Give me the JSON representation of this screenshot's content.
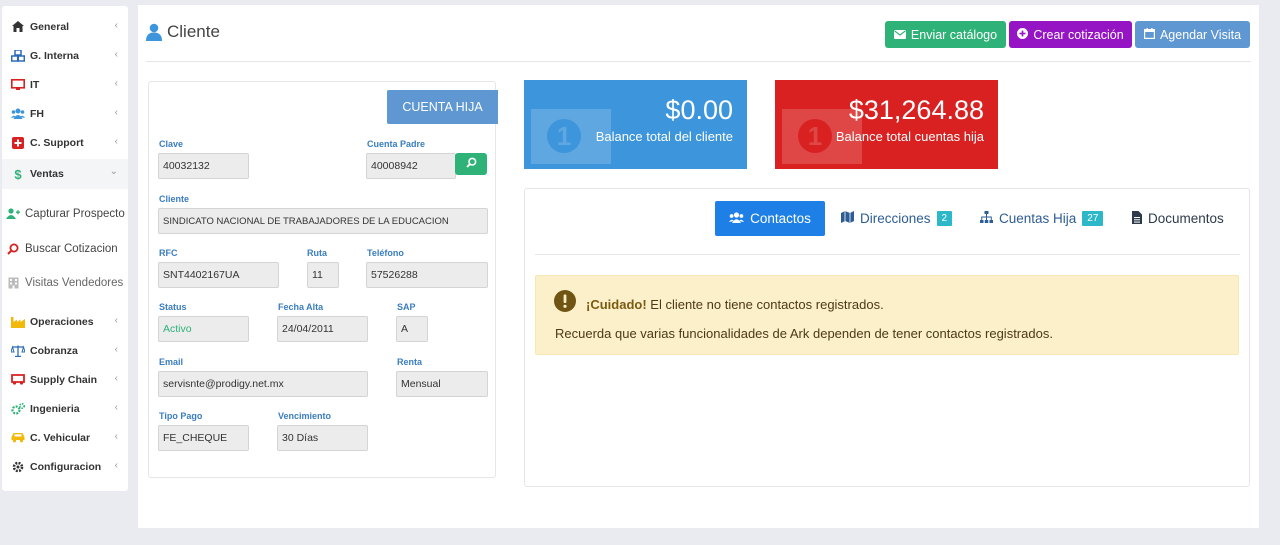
{
  "sidebar": {
    "items": [
      {
        "label": "General",
        "icon": "home-icon"
      },
      {
        "label": "G. Interna",
        "icon": "cubes-icon"
      },
      {
        "label": "IT",
        "icon": "desktop-icon"
      },
      {
        "label": "FH",
        "icon": "users-icon"
      },
      {
        "label": "C. Support",
        "icon": "plus-square-icon"
      },
      {
        "label": "Ventas",
        "icon": "dollar-icon"
      },
      {
        "label": "Capturar Prospecto",
        "icon": "user-plus-icon"
      },
      {
        "label": "Buscar Cotizacion",
        "icon": "search-icon"
      },
      {
        "label": "Visitas Vendedores",
        "icon": "building-icon"
      },
      {
        "label": "Operaciones",
        "icon": "industry-icon"
      },
      {
        "label": "Cobranza",
        "icon": "balance-scale-icon"
      },
      {
        "label": "Supply Chain",
        "icon": "truck-icon"
      },
      {
        "label": "Ingenieria",
        "icon": "cogs-icon"
      },
      {
        "label": "C. Vehicular",
        "icon": "car-icon"
      },
      {
        "label": "Configuracion",
        "icon": "gear-icon"
      }
    ]
  },
  "header": {
    "title": "Cliente",
    "buttons": {
      "catalog": "Enviar catálogo",
      "quote": "Crear cotización",
      "visit": "Agendar Visita"
    }
  },
  "client": {
    "account_badge": "CUENTA HIJA",
    "fields": {
      "clave": {
        "label": "Clave",
        "value": "40032132"
      },
      "cuenta_padre": {
        "label": "Cuenta Padre",
        "value": "40008942"
      },
      "cliente": {
        "label": "Cliente",
        "value": "SINDICATO NACIONAL DE TRABAJADORES DE LA EDUCACION"
      },
      "rfc": {
        "label": "RFC",
        "value": "SNT4402167UA"
      },
      "ruta": {
        "label": "Ruta",
        "value": "11"
      },
      "telefono": {
        "label": "Teléfono",
        "value": "57526288"
      },
      "status": {
        "label": "Status",
        "value": "Activo"
      },
      "fecha_alta": {
        "label": "Fecha Alta",
        "value": "24/04/2011"
      },
      "sap": {
        "label": "SAP",
        "value": "A"
      },
      "email": {
        "label": "Email",
        "value": "servisnte@prodigy.net.mx"
      },
      "renta": {
        "label": "Renta",
        "value": "Mensual"
      },
      "tipo_pago": {
        "label": "Tipo Pago",
        "value": "FE_CHEQUE"
      },
      "vencimiento": {
        "label": "Vencimiento",
        "value": "30 Días"
      }
    }
  },
  "balances": {
    "client": {
      "amount": "$0.00",
      "caption": "Balance total del cliente"
    },
    "child": {
      "amount": "$31,264.88",
      "caption": "Balance total cuentas hija"
    }
  },
  "tabs": {
    "contactos": {
      "label": "Contactos"
    },
    "direcciones": {
      "label": "Direcciones",
      "count": "2"
    },
    "cuentas_hija": {
      "label": "Cuentas Hija",
      "count": "27"
    },
    "documentos": {
      "label": "Documentos"
    }
  },
  "alert": {
    "strong": "¡Cuidado!",
    "message": " El cliente no tiene contactos registrados.",
    "detail": "Recuerda que varias funcionalidades de Ark dependen de tener contactos registrados."
  },
  "colors": {
    "success": "#2fb278",
    "purple": "#9515c4",
    "info": "#5e97d2",
    "primary": "#1e80e6",
    "danger": "#d92121",
    "card_blue": "#3d95db",
    "warning_bg": "#fcf0cb"
  }
}
